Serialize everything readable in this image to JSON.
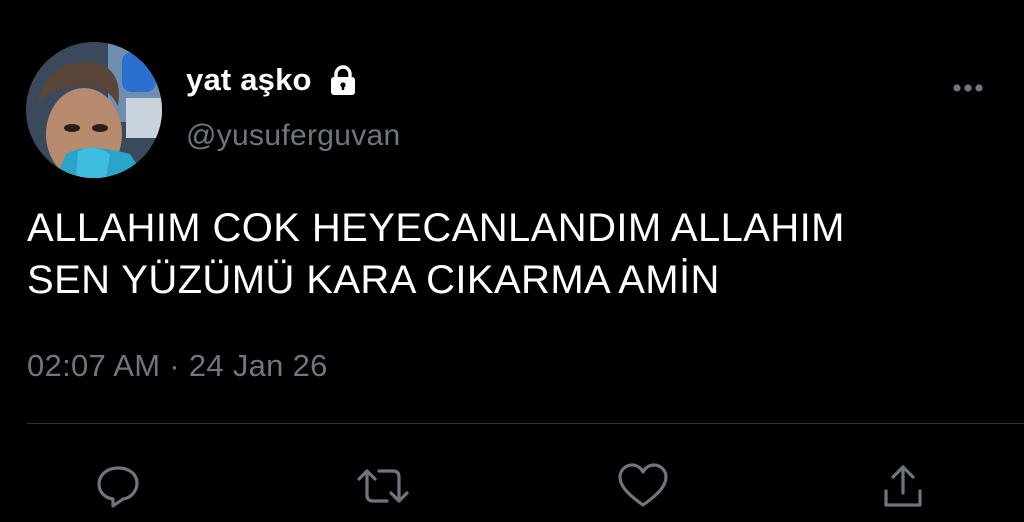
{
  "user": {
    "display_name": "yat aşko",
    "handle": "@yusuferguvan",
    "protected_icon": "lock-icon",
    "avatar_icon": "profile-photo"
  },
  "tweet": {
    "text_lines": [
      "ALLAHIM COK HEYECANLANDIM ALLAHIM",
      "SEN YÜZÜMÜ KARA CIKARMA AMİN"
    ],
    "timestamp": "02:07 AM · 24 Jan 26"
  },
  "actions": {
    "reply_icon": "reply-icon",
    "retweet_icon": "retweet-icon",
    "like_icon": "heart-icon",
    "share_icon": "share-icon",
    "more_icon": "more-dots-icon"
  },
  "colors": {
    "background": "#000000",
    "text": "#ffffff",
    "secondary": "#6e767d",
    "divider": "#2f3336"
  }
}
